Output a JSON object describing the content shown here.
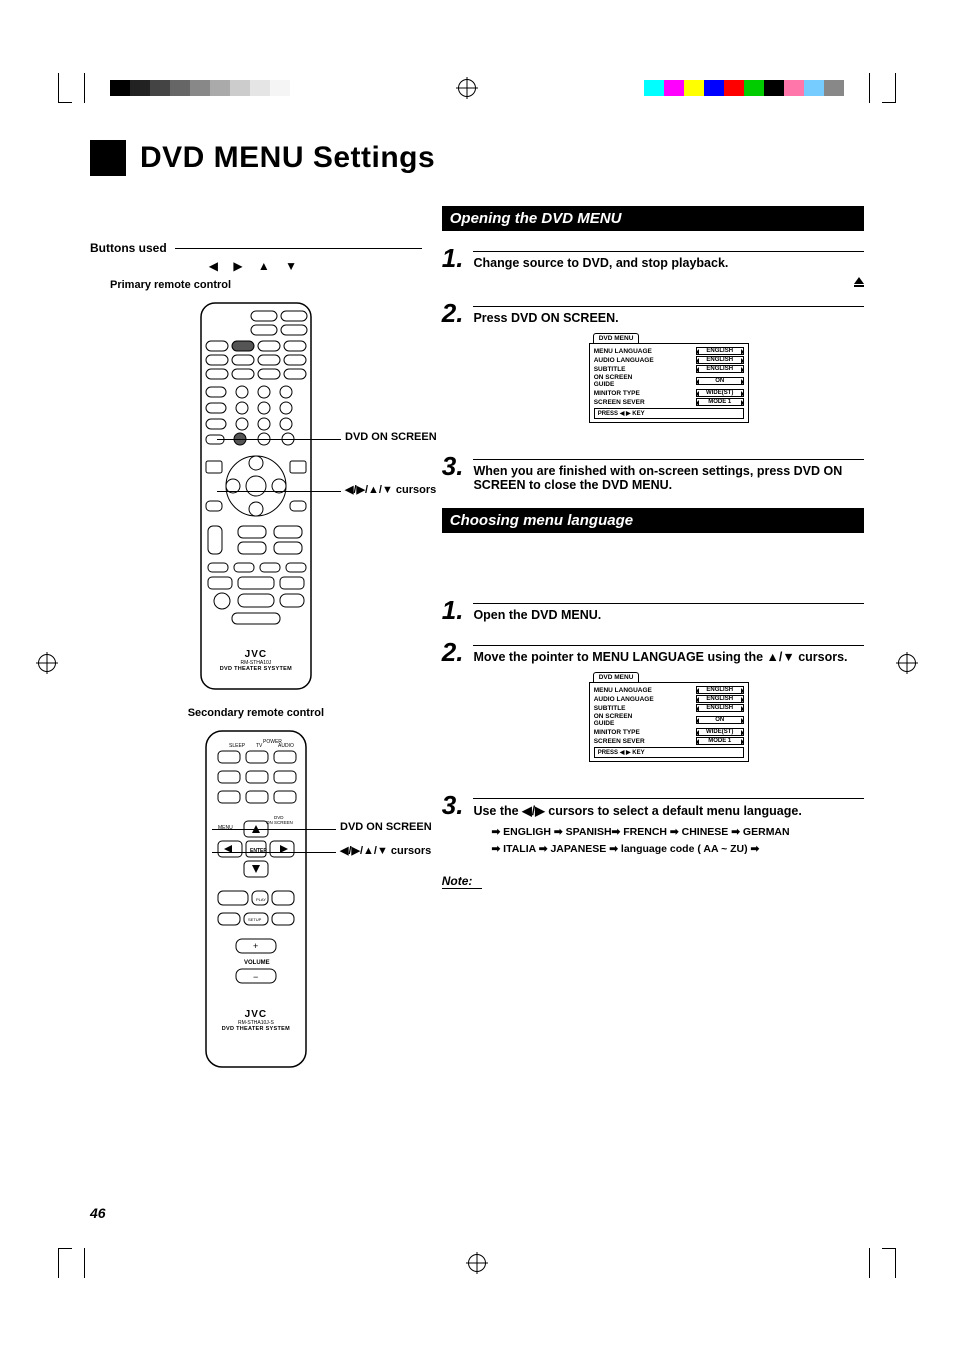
{
  "page_number": "46",
  "title": "DVD MENU Settings",
  "left": {
    "buttons_used": "Buttons used",
    "arrows": "◀ ▶ ▲ ▼",
    "primary_label": "Primary remote control",
    "secondary_label": "Secondary remote control",
    "callout_dvd_on_screen": "DVD ON SCREEN",
    "callout_cursors": "◀/▶/▲/▼ cursors",
    "jvc": "JVC",
    "theater1": "DVD THEATER SYSYTEM",
    "theater2": "DVD THEATER SYSTEM",
    "model1": "RM-STHA10J",
    "model2": "RM-STHA10J-S"
  },
  "right": {
    "section1_title": "Opening the DVD MENU",
    "s1_step1": "Change source to DVD, and stop playback.",
    "s1_step2": "Press DVD ON SCREEN.",
    "s1_step3": "When you are finished with on-screen settings, press DVD ON SCREEN to close the DVD MENU.",
    "section2_title": "Choosing menu language",
    "s2_step1": "Open the DVD MENU.",
    "s2_step2": "Move the pointer to MENU LANGUAGE using the ▲/▼ cursors.",
    "s2_step3": "Use the ◀/▶ cursors to select a default menu language.",
    "lang_chain_line1": "➡ ENGLIGH ➡ SPANISH➡ FRENCH ➡ CHINESE ➡ GERMAN",
    "lang_chain_line2": "➡ ITALIA ➡ JAPANESE ➡ language code ( AA ~ ZU) ➡",
    "note": "Note:",
    "menu_tab": "DVD MENU",
    "menu_rows": [
      {
        "label": "MENU LANGUAGE",
        "value": "ENGLISH"
      },
      {
        "label": "AUDIO LANGUAGE",
        "value": "ENGLISH"
      },
      {
        "label": "SUBTITLE",
        "value": "ENGLISH"
      },
      {
        "label": "ON SCREEN GUIDE",
        "value": "ON"
      },
      {
        "label": "MINITOR TYPE",
        "value": "WIDE(ST)"
      },
      {
        "label": "SCREEN SEVER",
        "value": "MODE 1"
      }
    ],
    "menu_footer": "PRESS ◀ ▶ KEY"
  }
}
